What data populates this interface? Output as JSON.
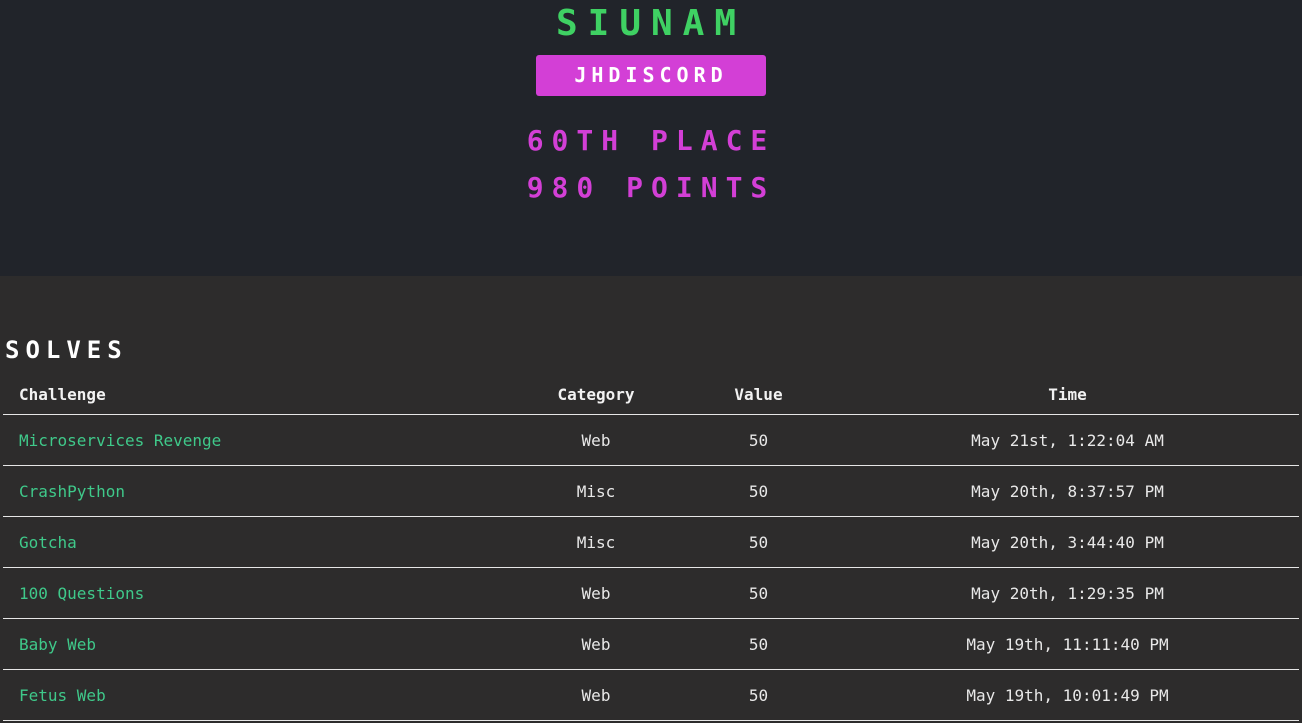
{
  "team": {
    "name": "SIUNAM",
    "badge": "JHDISCORD",
    "place": "60TH PLACE",
    "points": "980 POINTS"
  },
  "solves": {
    "heading": "SOLVES",
    "columns": {
      "challenge": "Challenge",
      "category": "Category",
      "value": "Value",
      "time": "Time"
    },
    "rows": [
      {
        "challenge": "Microservices Revenge",
        "category": "Web",
        "value": "50",
        "time": "May 21st, 1:22:04 AM"
      },
      {
        "challenge": "CrashPython",
        "category": "Misc",
        "value": "50",
        "time": "May 20th, 8:37:57 PM"
      },
      {
        "challenge": "Gotcha",
        "category": "Misc",
        "value": "50",
        "time": "May 20th, 3:44:40 PM"
      },
      {
        "challenge": "100 Questions",
        "category": "Web",
        "value": "50",
        "time": "May 20th, 1:29:35 PM"
      },
      {
        "challenge": "Baby Web",
        "category": "Web",
        "value": "50",
        "time": "May 19th, 11:11:40 PM"
      },
      {
        "challenge": "Fetus Web",
        "category": "Web",
        "value": "50",
        "time": "May 19th, 10:01:49 PM"
      }
    ]
  },
  "colors": {
    "hero_background": "#21242a",
    "page_background": "#2d2c2c",
    "team_name": "#3fd163",
    "accent_magenta": "#d33fd6",
    "link_green": "#3fc98a"
  }
}
